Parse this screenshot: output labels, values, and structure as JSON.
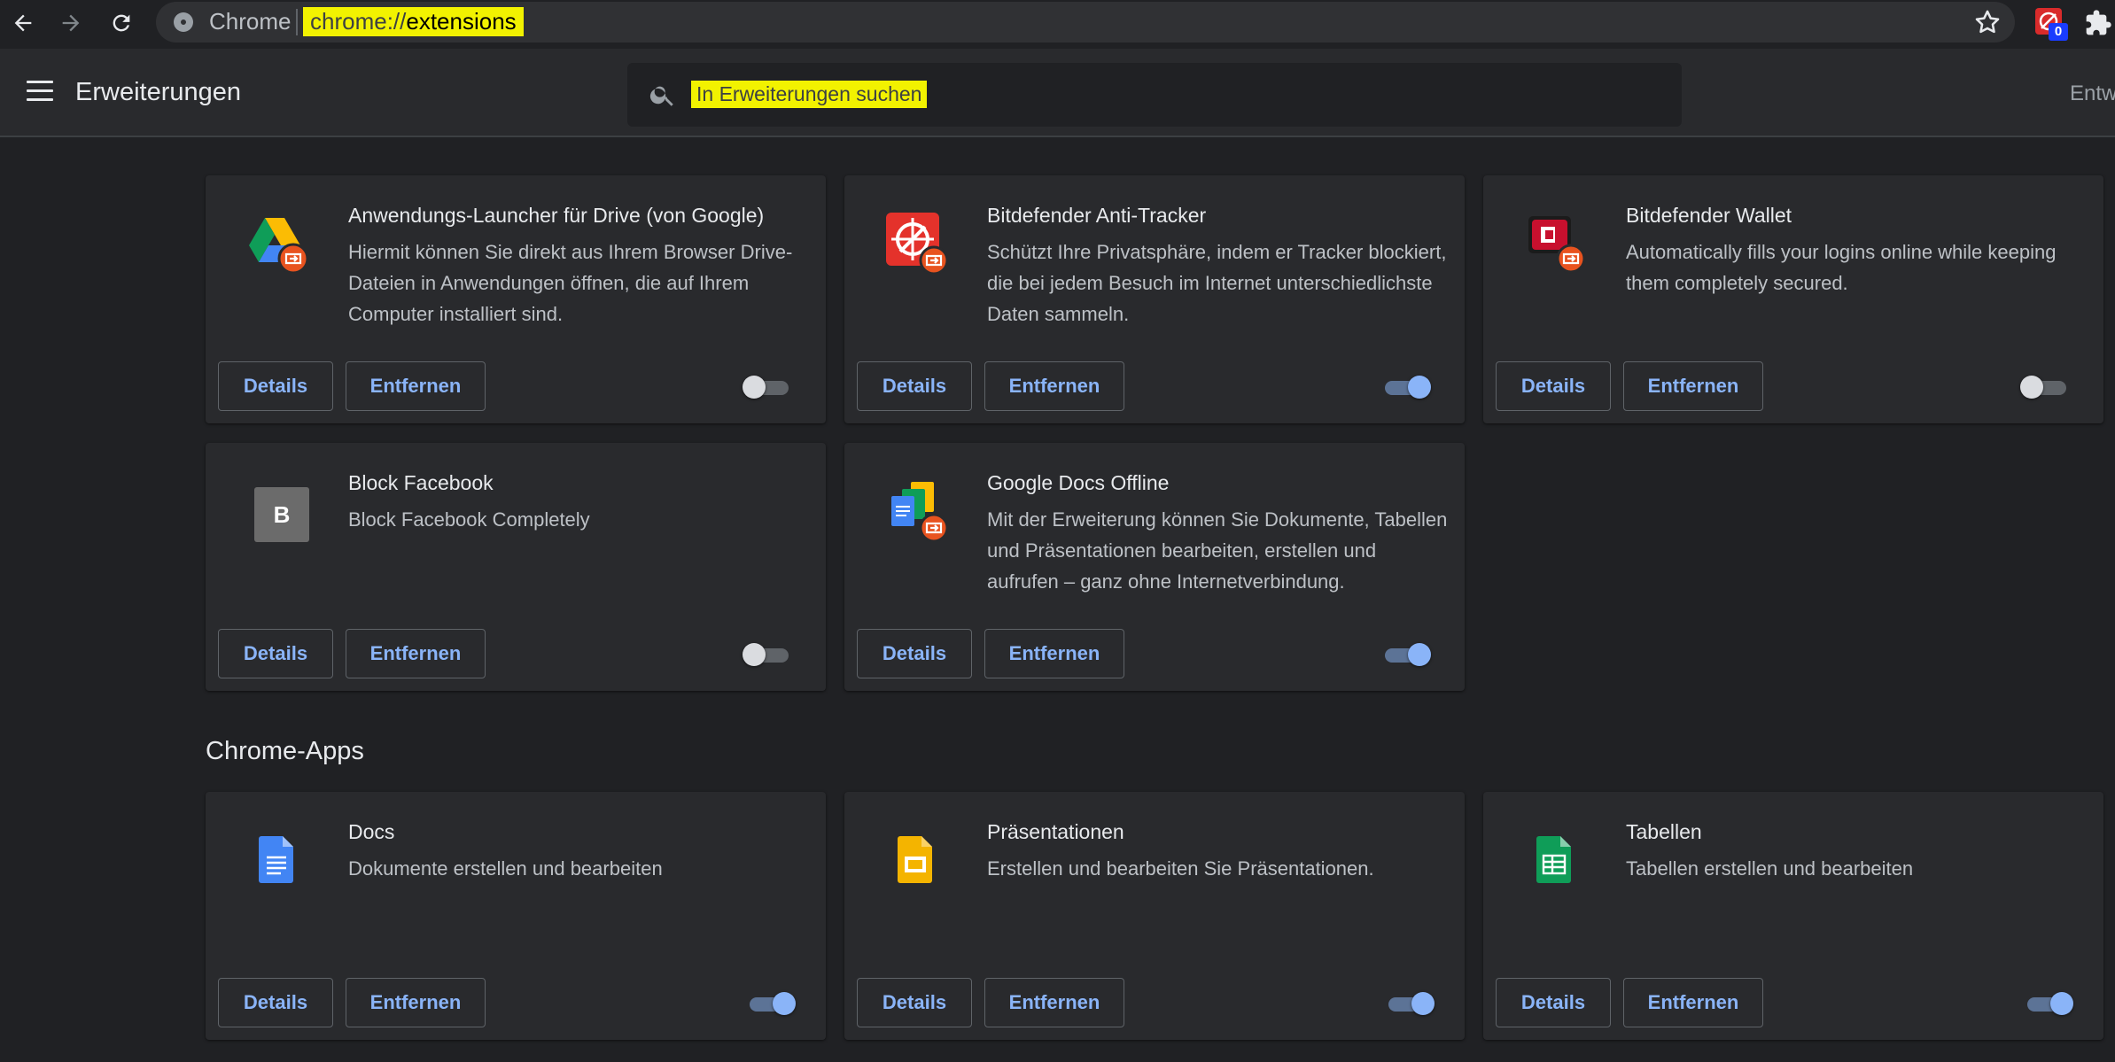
{
  "browser": {
    "site_label": "Chrome",
    "url_scheme": "chrome://",
    "url_host": "extensions",
    "extension_badge": "0"
  },
  "header": {
    "title": "Erweiterungen",
    "search_placeholder": "In Erweiterungen suchen",
    "developer_mode_label": "Entw"
  },
  "buttons": {
    "details": "Details",
    "remove": "Entfernen"
  },
  "extensions": [
    {
      "name": "Anwendungs-Launcher für Drive (von Google)",
      "description": "Hiermit können Sie direkt aus Ihrem Browser Drive-Dateien in Anwendungen öffnen, die auf Ihrem Computer installiert sind.",
      "icon": "google-drive-icon",
      "enabled": false
    },
    {
      "name": "Bitdefender Anti-Tracker",
      "description": "Schützt Ihre Privatsphäre, indem er Tracker blockiert, die bei jedem Besuch im Internet unterschiedlichste Daten sammeln.",
      "icon": "bitdefender-antitracker-icon",
      "enabled": true
    },
    {
      "name": "Bitdefender Wallet",
      "description": "Automatically fills your logins online while keeping them completely secured.",
      "icon": "bitdefender-wallet-icon",
      "enabled": false
    },
    {
      "name": "Block Facebook",
      "description": "Block Facebook Completely",
      "icon": "letter-b-icon",
      "icon_letter": "B",
      "enabled": false
    },
    {
      "name": "Google Docs Offline",
      "description": "Mit der Erweiterung können Sie Dokumente, Tabellen und Präsentationen bearbeiten, erstellen und aufrufen – ganz ohne Internetverbindung.",
      "icon": "google-docs-offline-icon",
      "enabled": true
    }
  ],
  "apps_section": {
    "title": "Chrome-Apps",
    "apps": [
      {
        "name": "Docs",
        "description": "Dokumente erstellen und bearbeiten",
        "icon": "google-docs-icon",
        "enabled": true
      },
      {
        "name": "Präsentationen",
        "description": "Erstellen und bearbeiten Sie Präsentationen.",
        "icon": "google-slides-icon",
        "enabled": true
      },
      {
        "name": "Tabellen",
        "description": "Tabellen erstellen und bearbeiten",
        "icon": "google-sheets-icon",
        "enabled": true
      }
    ]
  },
  "colors": {
    "background": "#202124",
    "card": "#292a2d",
    "accent": "#8ab4f8",
    "highlight": "#f2f200"
  }
}
